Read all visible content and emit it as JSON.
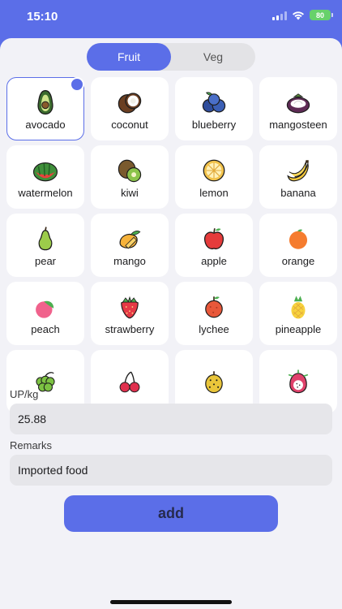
{
  "status": {
    "time": "15:10",
    "battery": "80"
  },
  "tabs": [
    {
      "label": "Fruit",
      "active": true
    },
    {
      "label": "Veg",
      "active": false
    }
  ],
  "grid": {
    "items": [
      {
        "label": "avocado",
        "icon": "avocado-icon",
        "selected": true
      },
      {
        "label": "coconut",
        "icon": "coconut-icon"
      },
      {
        "label": "blueberry",
        "icon": "blueberry-icon"
      },
      {
        "label": "mangosteen",
        "icon": "mangosteen-icon"
      },
      {
        "label": "watermelon",
        "icon": "watermelon-icon"
      },
      {
        "label": "kiwi",
        "icon": "kiwi-icon"
      },
      {
        "label": "lemon",
        "icon": "lemon-icon"
      },
      {
        "label": "banana",
        "icon": "banana-icon"
      },
      {
        "label": "pear",
        "icon": "pear-icon"
      },
      {
        "label": "mango",
        "icon": "mango-icon"
      },
      {
        "label": "apple",
        "icon": "apple-icon"
      },
      {
        "label": "orange",
        "icon": "orange-icon"
      },
      {
        "label": "peach",
        "icon": "peach-icon"
      },
      {
        "label": "strawberry",
        "icon": "strawberry-icon"
      },
      {
        "label": "lychee",
        "icon": "lychee-icon"
      },
      {
        "label": "pineapple",
        "icon": "pineapple-icon"
      },
      {
        "label": "",
        "icon": "grape-icon"
      },
      {
        "label": "",
        "icon": "cherry-icon"
      },
      {
        "label": "",
        "icon": "durian-icon"
      },
      {
        "label": "",
        "icon": "dragon-fruit-icon"
      }
    ]
  },
  "form": {
    "price_label": "UP/kg",
    "price_value": "25.88",
    "remarks_label": "Remarks",
    "remarks_value": "Imported food"
  },
  "actions": {
    "add_label": "add"
  },
  "colors": {
    "accent": "#5b6ee8",
    "sheet": "#f2f2f7",
    "field": "#e6e6ea",
    "battery": "#67d16b"
  }
}
